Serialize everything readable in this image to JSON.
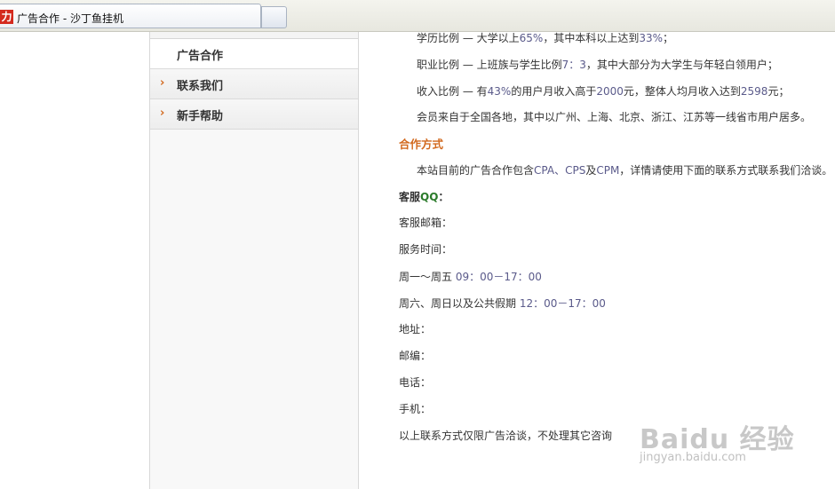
{
  "browser": {
    "tab_title": "广告合作 - 沙丁鱼挂机",
    "favicon_text": "力"
  },
  "sidebar": {
    "items": [
      {
        "label": "广告合作",
        "active": true
      },
      {
        "label": "联系我们",
        "active": false
      },
      {
        "label": "新手帮助",
        "active": false
      }
    ],
    "chevron": "›"
  },
  "content": {
    "stats": [
      {
        "prefix": "学历比例 — 大学以上",
        "n1": "65%",
        "mid": "，其中本科以上达到",
        "n2": "33%",
        "suffix": "；"
      },
      {
        "prefix": "职业比例 — 上班族与学生比例",
        "n1": "7：3",
        "mid": "，其中大部分为大学生与年轻白领用户；",
        "n2": "",
        "suffix": ""
      },
      {
        "prefix": "收入比例 — 有",
        "n1": "43%",
        "mid": "的用户月收入高于",
        "n2": "2000",
        "suffix": "元，整体人均月收入达到",
        "n3": "2598",
        "suffix2": "元；"
      },
      {
        "text": "会员来自于全国各地，其中以广州、上海、北京、浙江、江苏等一线省市用户居多。"
      }
    ],
    "coop_title": "合作方式",
    "coop_text": {
      "a": "本站目前的广告合作包含",
      "b": "CPA、CPS",
      "c": "及",
      "d": "CPM",
      "e": "，详情请使用下面的联系方式联系我们洽谈。"
    },
    "qq_label": "客服",
    "qq_suffix": "QQ",
    "qq_colon": "：",
    "email_label": "客服邮箱：",
    "service_time_label": "服务时间：",
    "weekday_label": "周一～周五 ",
    "weekday_time": "09：00－17：00",
    "weekend_label": "周六、周日以及公共假期 ",
    "weekend_time": "12：00－17：00",
    "address_label": "地址：",
    "postcode_label": "邮编：",
    "phone_label": "电话：",
    "mobile_label": "手机：",
    "notice": "以上联系方式仅限广告洽谈，不处理其它咨询"
  },
  "watermark": {
    "brand": "Baidu 经验",
    "url": "jingyan.baidu.com"
  },
  "colors": {
    "accent": "#d2691e",
    "qq_green": "#2a7a2a",
    "number": "#5a5a8a"
  }
}
